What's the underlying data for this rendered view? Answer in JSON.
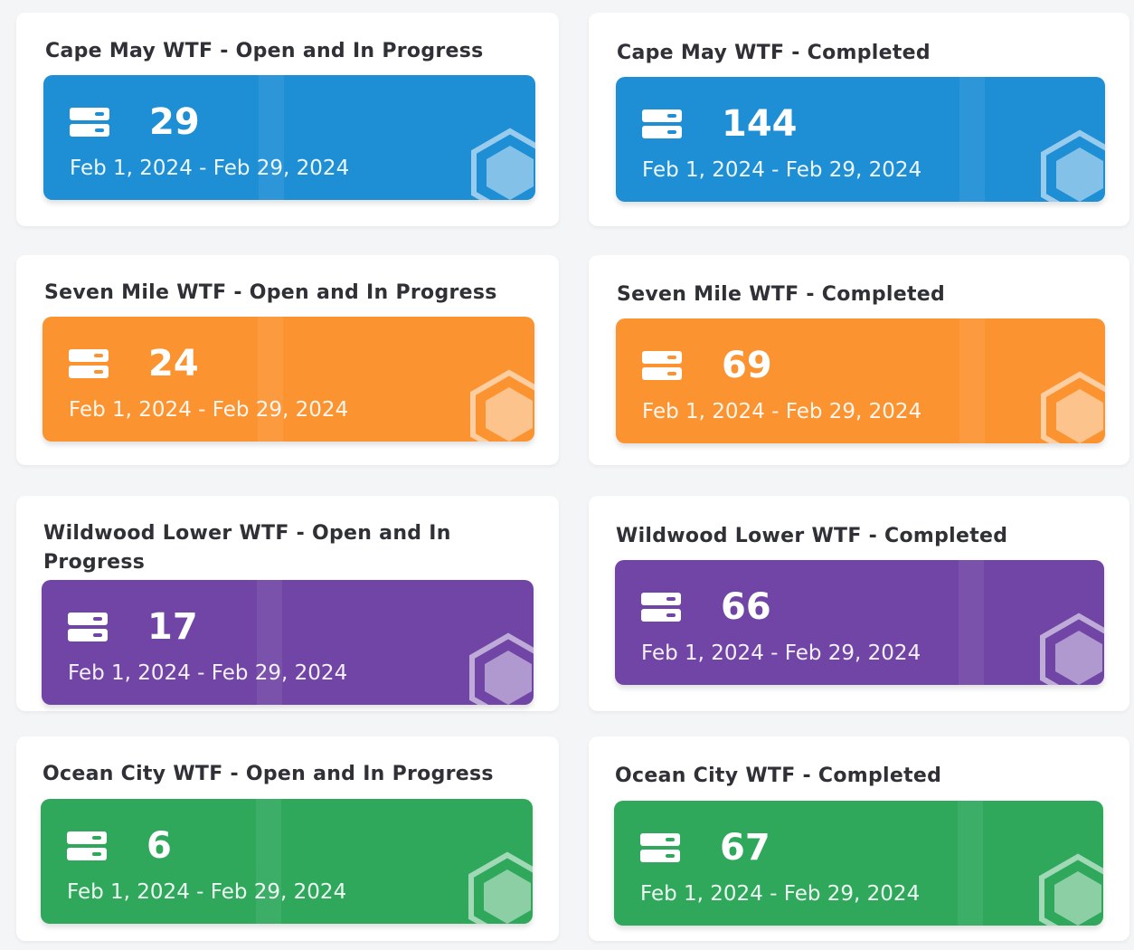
{
  "colors": {
    "blue": "#1e8fd5",
    "orange": "#fb9330",
    "purple": "#7045a6",
    "green": "#2fa85c"
  },
  "icons": {
    "card_icon": "server-icon",
    "card_decoration": "hexagon-icon"
  },
  "cards": [
    {
      "title": "Cape May WTF - Open and In Progress",
      "count": "29",
      "dates": "Feb 1, 2024 - Feb 29, 2024",
      "color": "blue"
    },
    {
      "title": "Cape May WTF - Completed",
      "count": "144",
      "dates": "Feb 1, 2024 - Feb 29, 2024",
      "color": "blue"
    },
    {
      "title": "Seven Mile WTF - Open and In Progress",
      "count": "24",
      "dates": "Feb 1, 2024 - Feb 29, 2024",
      "color": "orange"
    },
    {
      "title": "Seven Mile WTF - Completed",
      "count": "69",
      "dates": "Feb 1, 2024 - Feb 29, 2024",
      "color": "orange"
    },
    {
      "title": "Wildwood Lower WTF - Open and In Progress",
      "count": "17",
      "dates": "Feb 1, 2024 - Feb 29, 2024",
      "color": "purple"
    },
    {
      "title": "Wildwood Lower WTF -  Completed",
      "count": "66",
      "dates": "Feb 1, 2024 - Feb 29, 2024",
      "color": "purple"
    },
    {
      "title": "Ocean City WTF - Open and In Progress",
      "count": "6",
      "dates": "Feb 1, 2024 - Feb 29, 2024",
      "color": "green"
    },
    {
      "title": "Ocean City WTF - Completed",
      "count": "67",
      "dates": "Feb 1, 2024 - Feb 29, 2024",
      "color": "green"
    }
  ]
}
